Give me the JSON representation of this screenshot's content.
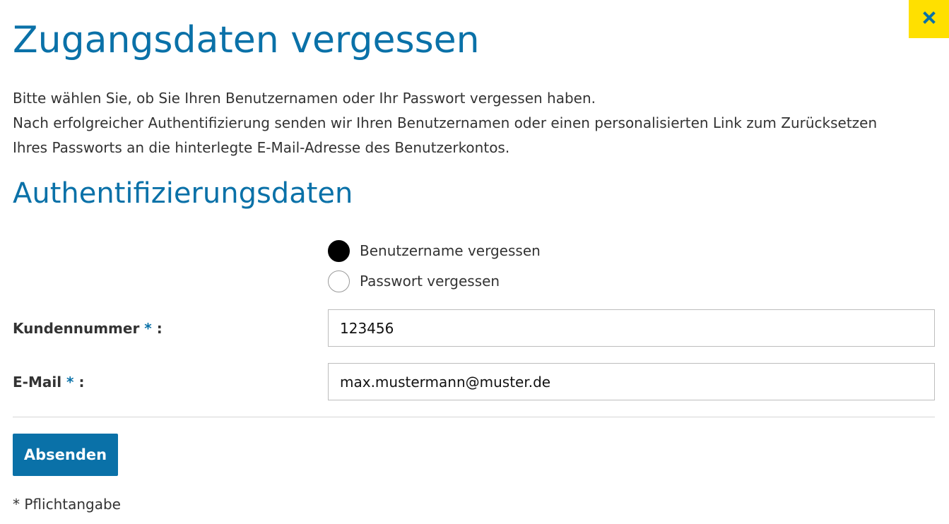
{
  "dialog": {
    "title": "Zugangsdaten vergessen",
    "close_icon": "close-icon",
    "intro": [
      "Bitte wählen Sie, ob Sie Ihren Benutzernamen oder Ihr Passwort vergessen haben.",
      "Nach erfolgreicher Authentifizierung senden wir Ihren Benutzernamen oder einen personalisierten Link zum Zurücksetzen",
      "Ihres Passworts an die hinterlegte E-Mail-Adresse des Benutzerkontos."
    ]
  },
  "auth": {
    "section_title": "Authentifizierungsdaten",
    "options": [
      {
        "label": "Benutzername vergessen",
        "selected": true
      },
      {
        "label": "Passwort vergessen",
        "selected": false
      }
    ],
    "fields": [
      {
        "label": "Kundennummer",
        "required_mark": "*",
        "suffix": ":",
        "value": "123456"
      },
      {
        "label": "E-Mail",
        "required_mark": "*",
        "suffix": ":",
        "value": "max.mustermann@muster.de"
      }
    ],
    "submit_label": "Absenden",
    "footnote": "* Pflichtangabe"
  },
  "colors": {
    "accent": "#0a71a8",
    "close_bg": "#ffe000",
    "text": "#333333",
    "radio_checked": "#000000"
  }
}
